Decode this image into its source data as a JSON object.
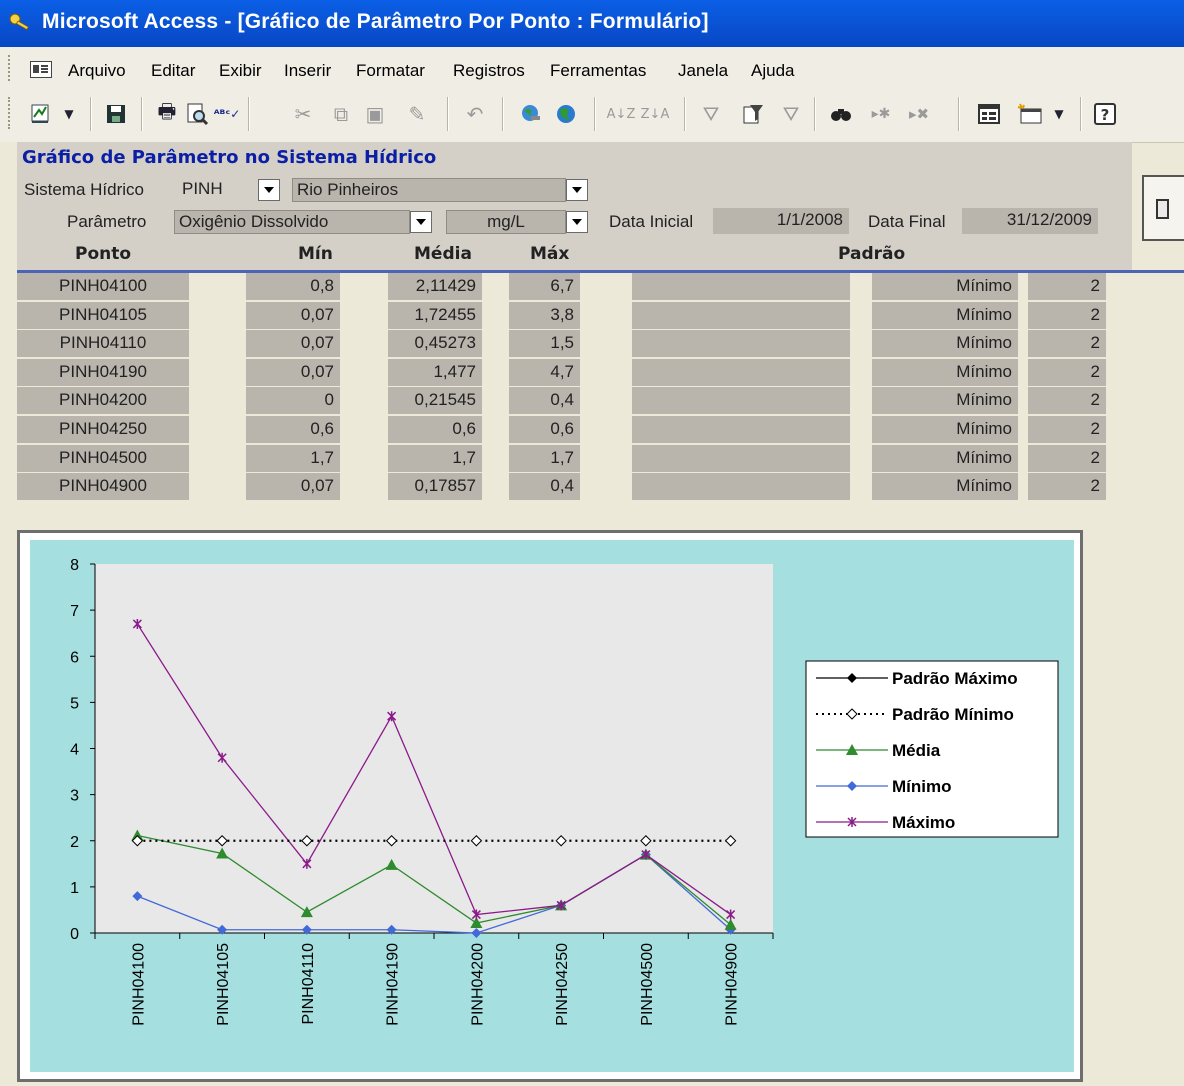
{
  "window": {
    "title": "Microsoft Access - [Gráfico de Parâmetro Por Ponto : Formulário]"
  },
  "menu": {
    "items": [
      "Arquivo",
      "Editar",
      "Exibir",
      "Inserir",
      "Formatar",
      "Registros",
      "Ferramentas",
      "Janela",
      "Ajuda"
    ]
  },
  "toolbar": {
    "icons": [
      "view-icon",
      "save-icon",
      "print-icon",
      "print-preview-icon",
      "spelling-icon",
      "cut-icon",
      "copy-icon",
      "paste-icon",
      "format-painter-icon",
      "undo-icon",
      "insert-hyperlink-icon",
      "web-toolbar-icon",
      "sort-ascending-icon",
      "sort-descending-icon",
      "filter-by-selection-icon",
      "filter-by-form-icon",
      "apply-filter-icon",
      "find-icon",
      "new-record-icon",
      "delete-record-icon",
      "database-window-icon",
      "new-object-icon",
      "help-icon"
    ]
  },
  "form": {
    "title": "Gráfico de Parâmetro no Sistema Hídrico",
    "sistema_label": "Sistema Hídrico",
    "sistema_code": "PINH",
    "sistema_name": "Rio Pinheiros",
    "parametro_label": "Parâmetro",
    "parametro_value": "Oxigênio Dissolvido",
    "unit_value": "mg/L",
    "data_inicial_label": "Data Inicial",
    "data_inicial_value": "1/1/2008",
    "data_final_label": "Data Final",
    "data_final_value": "31/12/2009"
  },
  "table": {
    "headers": {
      "ponto": "Ponto",
      "min": "Mín",
      "media": "Média",
      "max": "Máx",
      "padrao": "Padrão"
    },
    "rows": [
      {
        "ponto": "PINH04100",
        "min": "0,8",
        "media": "2,11429",
        "max": "6,7",
        "padrao_tipo": "Mínimo",
        "padrao_valor": "2"
      },
      {
        "ponto": "PINH04105",
        "min": "0,07",
        "media": "1,72455",
        "max": "3,8",
        "padrao_tipo": "Mínimo",
        "padrao_valor": "2"
      },
      {
        "ponto": "PINH04110",
        "min": "0,07",
        "media": "0,45273",
        "max": "1,5",
        "padrao_tipo": "Mínimo",
        "padrao_valor": "2"
      },
      {
        "ponto": "PINH04190",
        "min": "0,07",
        "media": "1,477",
        "max": "4,7",
        "padrao_tipo": "Mínimo",
        "padrao_valor": "2"
      },
      {
        "ponto": "PINH04200",
        "min": "0",
        "media": "0,21545",
        "max": "0,4",
        "padrao_tipo": "Mínimo",
        "padrao_valor": "2"
      },
      {
        "ponto": "PINH04250",
        "min": "0,6",
        "media": "0,6",
        "max": "0,6",
        "padrao_tipo": "Mínimo",
        "padrao_valor": "2"
      },
      {
        "ponto": "PINH04500",
        "min": "1,7",
        "media": "1,7",
        "max": "1,7",
        "padrao_tipo": "Mínimo",
        "padrao_valor": "2"
      },
      {
        "ponto": "PINH04900",
        "min": "0,07",
        "media": "0,17857",
        "max": "0,4",
        "padrao_tipo": "Mínimo",
        "padrao_valor": "2"
      }
    ]
  },
  "chart_data": {
    "type": "line",
    "categories": [
      "PINH04100",
      "PINH04105",
      "PINH04110",
      "PINH04190",
      "PINH04200",
      "PINH04250",
      "PINH04500",
      "PINH04900"
    ],
    "ylim": [
      0,
      8
    ],
    "yticks": [
      0,
      1,
      2,
      3,
      4,
      5,
      6,
      7,
      8
    ],
    "grid": false,
    "legend_position": "right",
    "series": [
      {
        "name": "Padrão Máximo",
        "values": [
          null,
          null,
          null,
          null,
          null,
          null,
          null,
          null
        ],
        "color": "#000000",
        "style": "solid",
        "marker": "diamond-filled"
      },
      {
        "name": "Padrão Mínimo",
        "values": [
          2,
          2,
          2,
          2,
          2,
          2,
          2,
          2
        ],
        "color": "#000000",
        "style": "dotted",
        "marker": "diamond-open"
      },
      {
        "name": "Média",
        "values": [
          2.11429,
          1.72455,
          0.45273,
          1.477,
          0.21545,
          0.6,
          1.7,
          0.17857
        ],
        "color": "#2e8b2e",
        "style": "solid",
        "marker": "triangle"
      },
      {
        "name": "Mínimo",
        "values": [
          0.8,
          0.07,
          0.07,
          0.07,
          0,
          0.6,
          1.7,
          0.07
        ],
        "color": "#4169d8",
        "style": "solid",
        "marker": "diamond-filled"
      },
      {
        "name": "Máximo",
        "values": [
          6.7,
          3.8,
          1.5,
          4.7,
          0.4,
          0.6,
          1.7,
          0.4
        ],
        "color": "#8b1a8b",
        "style": "solid",
        "marker": "star"
      }
    ]
  }
}
